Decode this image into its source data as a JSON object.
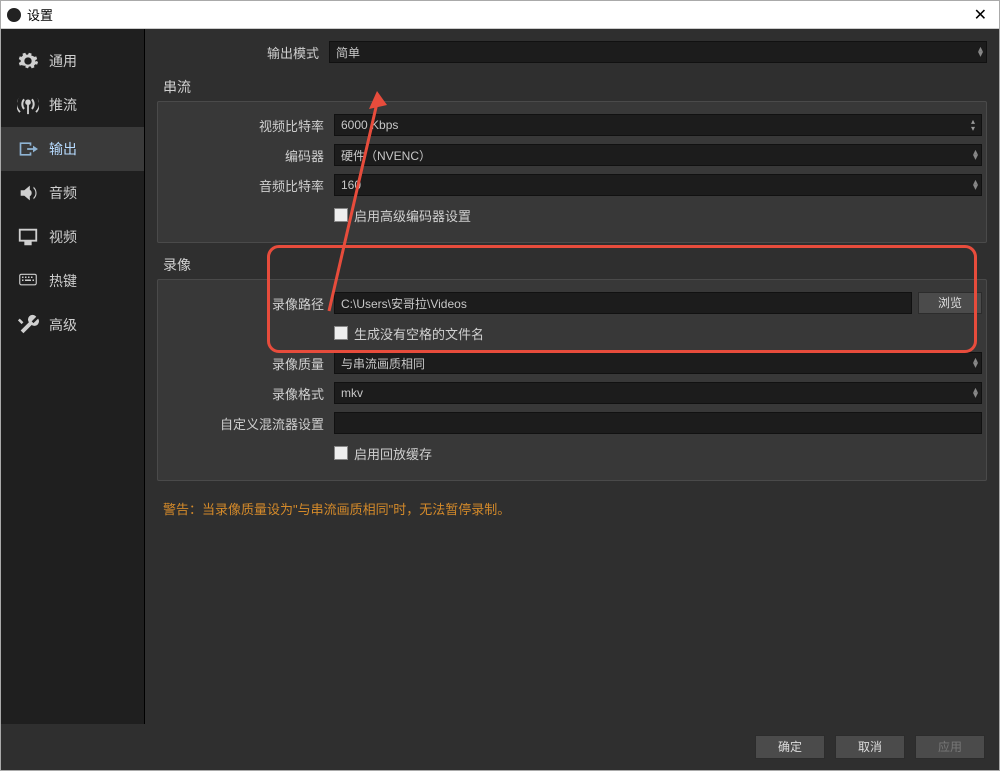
{
  "window": {
    "title": "设置"
  },
  "sidebar": {
    "items": [
      {
        "label": "通用"
      },
      {
        "label": "推流"
      },
      {
        "label": "输出"
      },
      {
        "label": "音频"
      },
      {
        "label": "视频"
      },
      {
        "label": "热键"
      },
      {
        "label": "高级"
      }
    ],
    "selected_index": 2
  },
  "output_mode": {
    "label": "输出模式",
    "value": "简单"
  },
  "streaming": {
    "group_title": "串流",
    "video_bitrate": {
      "label": "视频比特率",
      "value": "6000 Kbps"
    },
    "encoder": {
      "label": "编码器",
      "value": "硬件（NVENC）"
    },
    "audio_bitrate": {
      "label": "音频比特率",
      "value": "160"
    },
    "advanced_encoder_checkbox": {
      "label": "启用高级编码器设置"
    }
  },
  "recording": {
    "group_title": "录像",
    "path": {
      "label": "录像路径",
      "value": "C:\\Users\\安哥拉\\Videos",
      "browse": "浏览"
    },
    "no_space_filename": {
      "label": "生成没有空格的文件名"
    },
    "quality": {
      "label": "录像质量",
      "value": "与串流画质相同"
    },
    "format": {
      "label": "录像格式",
      "value": "mkv"
    },
    "muxer": {
      "label": "自定义混流器设置",
      "value": ""
    },
    "replay_buffer": {
      "label": "启用回放缓存"
    }
  },
  "warning": "警告：当录像质量设为\"与串流画质相同\"时，无法暂停录制。",
  "footer": {
    "ok": "确定",
    "cancel": "取消",
    "apply": "应用"
  }
}
